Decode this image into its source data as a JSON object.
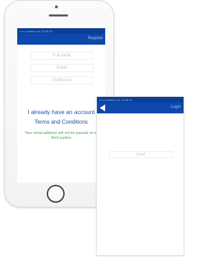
{
  "register_screen": {
    "status_text": "••••• vodafone UK  10:38:23",
    "nav_button": "Register",
    "fields": [
      "Full name",
      "Email",
      "Profession"
    ],
    "have_account_link": "I already have an account",
    "terms_link": "Terms and Conditions",
    "privacy_note": "Your email address will not be passed on to third parties"
  },
  "login_screen": {
    "status_text": "••••• vodafone UK  10:38:23",
    "nav_button": "Login",
    "email_field": "Email"
  },
  "colors": {
    "nav": "#0d48ad",
    "status": "#0b3f96",
    "link": "#1a50b0",
    "note": "#4ca055"
  }
}
